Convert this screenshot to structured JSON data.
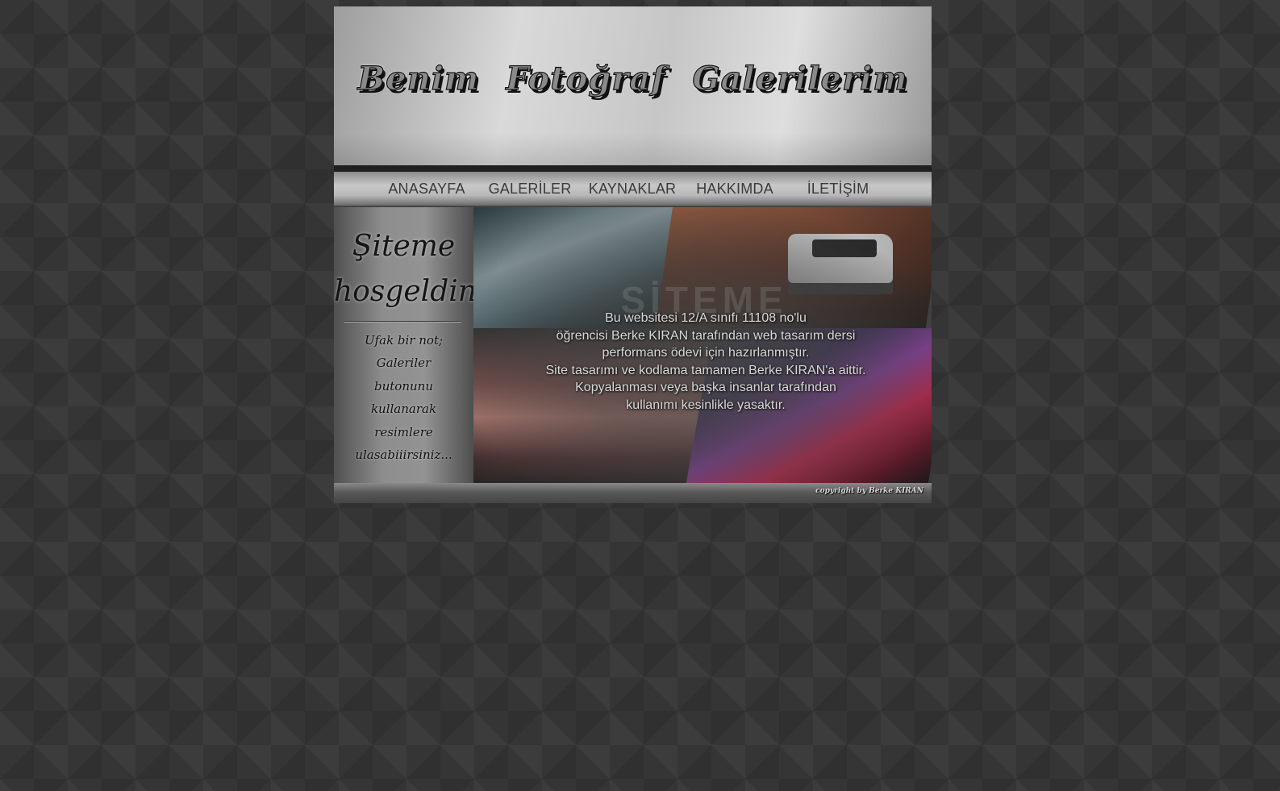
{
  "header": {
    "site_title": "Benim Fotoğraf Galerilerim"
  },
  "nav": {
    "items": [
      {
        "label": "ANASAYFA"
      },
      {
        "label": "GALERİLER"
      },
      {
        "label": "KAYNAKLAR"
      },
      {
        "label": "HAKKIMDA"
      },
      {
        "label": "İLETİŞİM"
      }
    ]
  },
  "sidebar": {
    "welcome_line1": "Şiteme",
    "welcome_line2": "hosgeldiniz",
    "note_lines": [
      "Ufak bir not;",
      "Galeriler",
      "butonunu",
      "kullanarak",
      "resimlere",
      "ulasabiiirsiniz..."
    ]
  },
  "main": {
    "watermark": "SİTEME",
    "info_lines": [
      "Bu websitesi 12/A sınıfı 11108 no'lu",
      "öğrencisi Berke KIRAN tarafından web tasarım dersi",
      "performans ödevi için hazırlanmıştır.",
      "Site tasarımı ve kodlama tamamen Berke KIRAN'a aittir.",
      "Kopyalanması veya başka insanlar tarafından",
      "kullanımı kesinlikle yasaktır."
    ]
  },
  "footer": {
    "copyright": "copyright by Berke KIRAN"
  }
}
